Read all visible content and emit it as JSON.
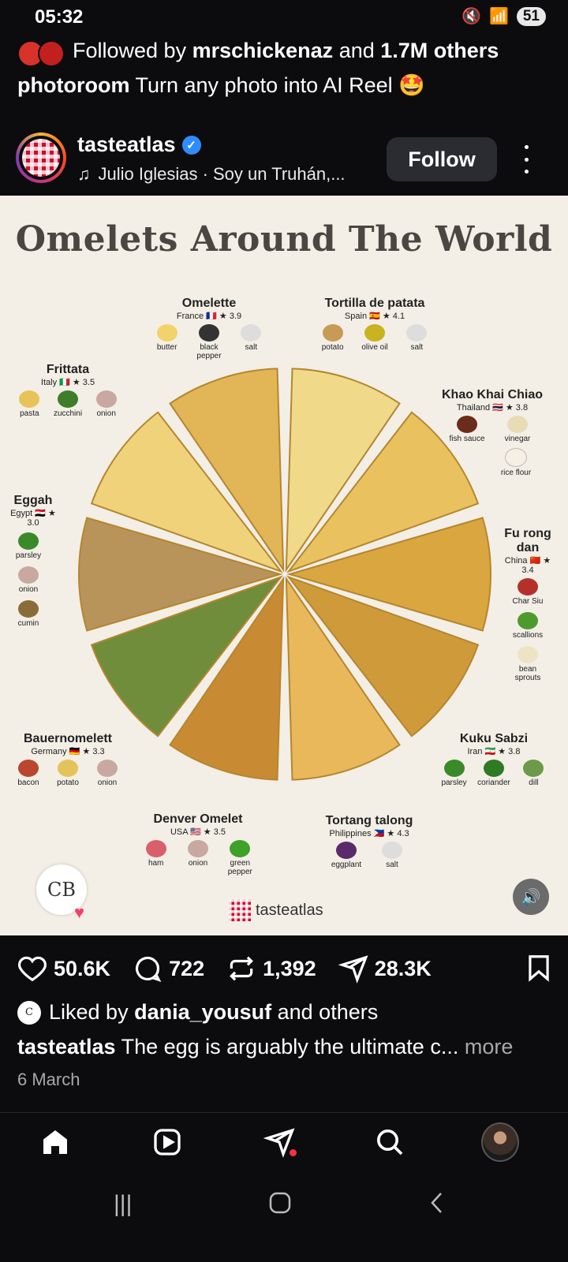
{
  "status_bar": {
    "time": "05:32",
    "battery": "51"
  },
  "followed_line": {
    "prefix": "Followed by ",
    "user": "mrschickenaz",
    "middle": " and ",
    "count": "1.7M others"
  },
  "ad_line": {
    "account": "photoroom",
    "text": " Turn any photo into AI Reel 🤩"
  },
  "header": {
    "username": "tasteatlas",
    "audio": "Julio Iglesias · Soy un Truhán,...",
    "follow_label": "Follow"
  },
  "post": {
    "title": "Omelets Around The World",
    "brand": "tasteatlas",
    "watermark": "CB",
    "dishes": [
      {
        "name": "Omelette",
        "meta": "France 🇫🇷 ★ 3.9",
        "ingredients": [
          "butter",
          "black pepper",
          "salt"
        ]
      },
      {
        "name": "Tortilla de patata",
        "meta": "Spain 🇪🇸 ★ 4.1",
        "ingredients": [
          "potato",
          "olive oil",
          "salt"
        ]
      },
      {
        "name": "Frittata",
        "meta": "Italy 🇮🇹 ★ 3.5",
        "ingredients": [
          "pasta",
          "zucchini",
          "onion"
        ]
      },
      {
        "name": "Khao Khai Chiao",
        "meta": "Thailand 🇹🇭 ★ 3.8",
        "ingredients": [
          "fish sauce",
          "vinegar",
          "rice flour"
        ]
      },
      {
        "name": "Eggah",
        "meta": "Egypt 🇪🇬 ★ 3.0",
        "ingredients": [
          "parsley",
          "onion",
          "cumin"
        ]
      },
      {
        "name": "Fu rong dan",
        "meta": "China 🇨🇳 ★ 3.4",
        "ingredients": [
          "Char Siu",
          "scallions",
          "bean sprouts"
        ]
      },
      {
        "name": "Bauernomelett",
        "meta": "Germany 🇩🇪 ★ 3.3",
        "ingredients": [
          "bacon",
          "potato",
          "onion"
        ]
      },
      {
        "name": "Kuku Sabzi",
        "meta": "Iran 🇮🇷 ★ 3.8",
        "ingredients": [
          "parsley",
          "coriander",
          "dill"
        ]
      },
      {
        "name": "Denver Omelet",
        "meta": "USA 🇺🇸 ★ 3.5",
        "ingredients": [
          "ham",
          "onion",
          "green pepper"
        ]
      },
      {
        "name": "Tortang talong",
        "meta": "Philippines 🇵🇭 ★ 4.3",
        "ingredients": [
          "eggplant",
          "salt"
        ]
      }
    ],
    "slice_colors": [
      "#f1d98a",
      "#e9c25f",
      "#d9a640",
      "#cf9a3a",
      "#e8b85a",
      "#c98a34",
      "#6f8d3a",
      "#b8935a",
      "#f0d27a",
      "#e2b557"
    ]
  },
  "actions": {
    "likes": "50.6K",
    "comments": "722",
    "reposts": "1,392",
    "shares": "28.3K"
  },
  "liked_by": {
    "prefix": "Liked by ",
    "user": "dania_yousuf",
    "suffix": " and others"
  },
  "caption": {
    "user": "tasteatlas",
    "text": " The egg is arguably the ultimate c...",
    "more": " more"
  },
  "date": "6 March",
  "icons": {
    "nav": [
      "home-icon",
      "reels-icon",
      "send-icon",
      "search-icon",
      "profile-avatar"
    ],
    "system": [
      "recents-icon",
      "home-circle-icon",
      "back-icon"
    ]
  }
}
